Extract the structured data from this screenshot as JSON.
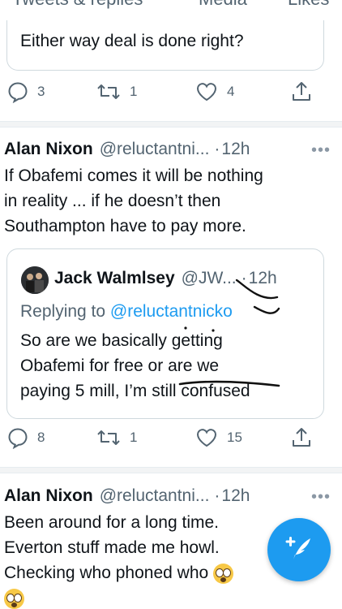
{
  "tabs": [
    {
      "label": "Tweets & replies"
    },
    {
      "label": "Media"
    },
    {
      "label": "Likes"
    }
  ],
  "previous_tweet": {
    "quote_tail_text": "Either way deal is done right?",
    "actions": {
      "replies": "3",
      "retweets": "1",
      "likes": "4"
    }
  },
  "tweet": {
    "name": "Alan Nixon",
    "handle": "@reluctantni...",
    "separator": "·",
    "time": "12h",
    "more": "•••",
    "lines": [
      "If Obafemi comes it will be nothing",
      "in reality ... if he doesn’t then",
      "Southampton have to pay more."
    ],
    "quote": {
      "name": "Jack Walmlsey",
      "handle": "@JW...",
      "separator": "·",
      "time": "12h",
      "replying_prefix": "Replying to",
      "replying_handle": "@reluctantnicko",
      "lines": [
        "So are we basically getting",
        "Obafemi for free or are we",
        "paying 5 mill, I’m still confused"
      ]
    },
    "actions": {
      "replies": "8",
      "retweets": "1",
      "likes": "15"
    }
  },
  "next_tweet": {
    "name": "Alan Nixon",
    "handle": "@reluctantni...",
    "separator": "·",
    "time": "12h",
    "more": "•••",
    "lines": [
      "Been around for a long time.",
      "Everton stuff made me howl.",
      "Checking who phoned who"
    ]
  },
  "fab": {
    "icon": "compose-feather-icon",
    "label": "+"
  },
  "colors": {
    "accent": "#1d9bf0",
    "secondary_text": "#536471",
    "border": "#cfd9de"
  }
}
